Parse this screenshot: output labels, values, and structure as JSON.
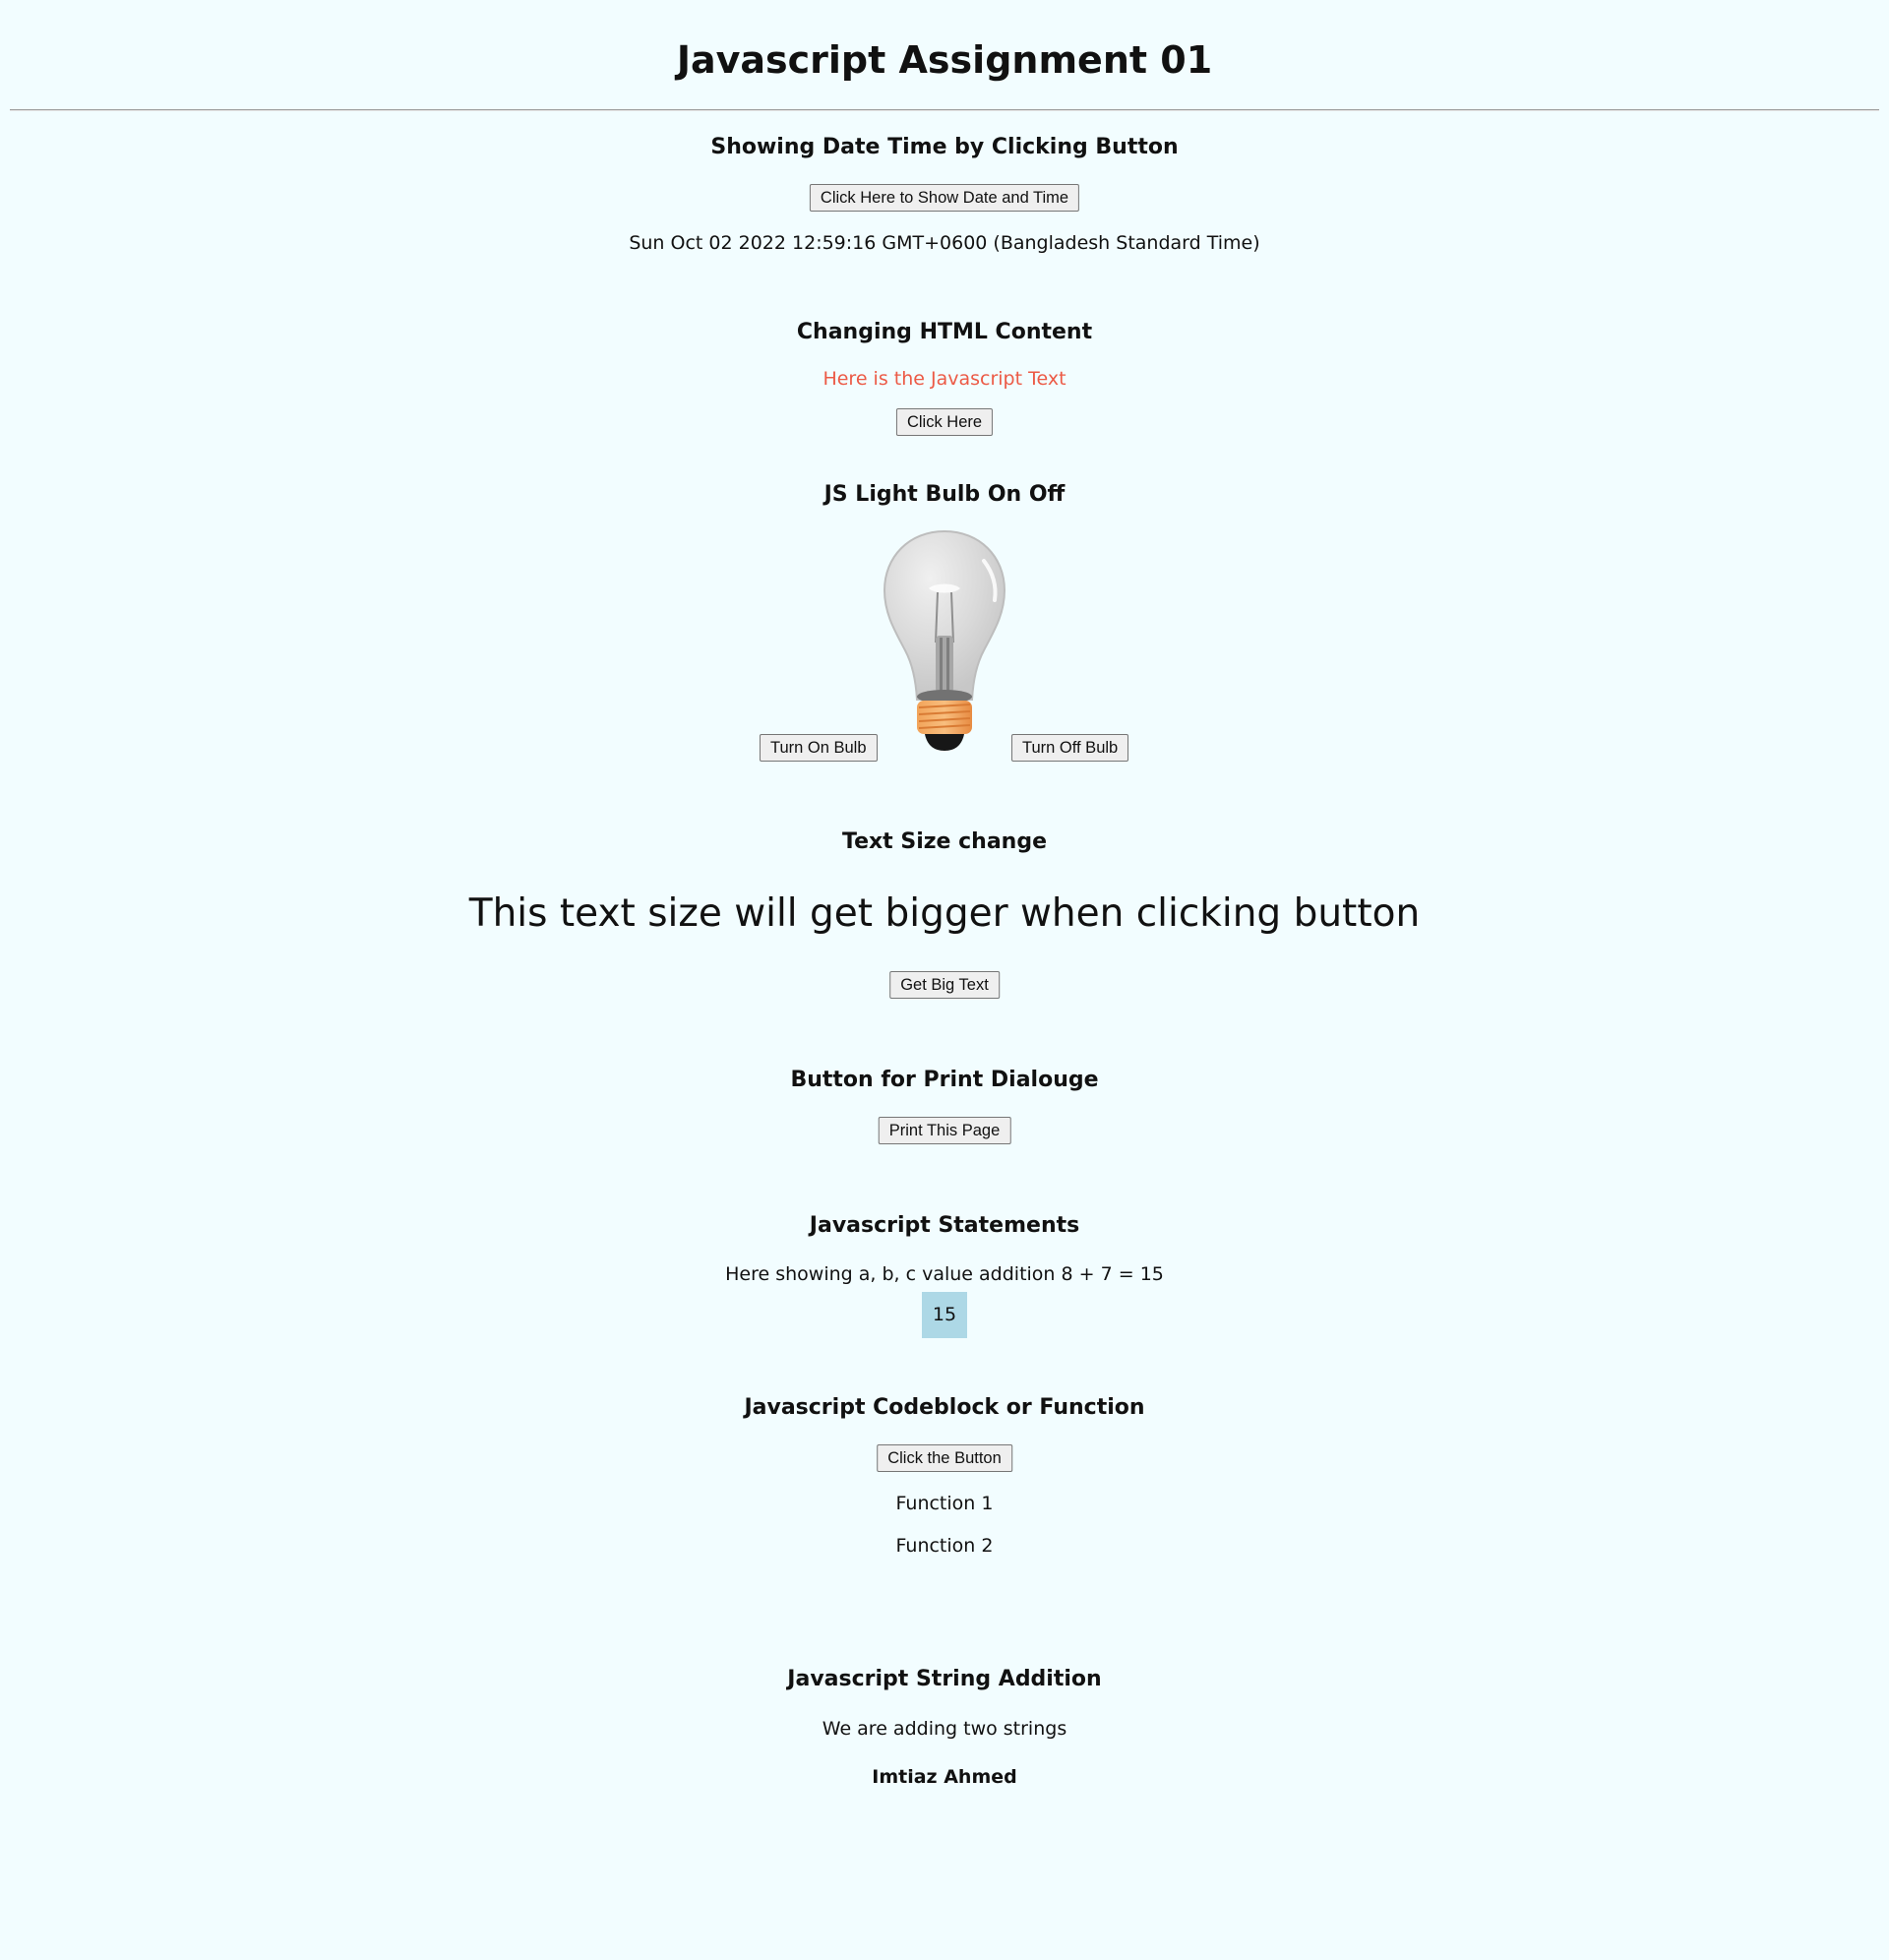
{
  "page": {
    "title": "Javascript Assignment 01"
  },
  "datetime_section": {
    "heading": "Showing Date Time by Clicking Button",
    "button_label": "Click Here to Show Date and Time",
    "output": "Sun Oct 02 2022 12:59:16 GMT+0600 (Bangladesh Standard Time)"
  },
  "html_content_section": {
    "heading": "Changing HTML Content",
    "text": "Here is the Javascript Text",
    "text_color": "#ec5a46",
    "button_label": "Click Here"
  },
  "bulb_section": {
    "heading": "JS Light Bulb On Off",
    "bulb_icon": "light-bulb-off",
    "on_button_label": "Turn On Bulb",
    "off_button_label": "Turn Off Bulb"
  },
  "text_size_section": {
    "heading": "Text Size change",
    "text": "This text size will get bigger when clicking button",
    "button_label": "Get Big Text"
  },
  "print_section": {
    "heading": "Button for Print Dialouge",
    "button_label": "Print This Page"
  },
  "statements_section": {
    "heading": "Javascript Statements",
    "text": "Here showing a, b, c value addition 8 + 7 = 15",
    "result": "15",
    "result_background": "#add8e6"
  },
  "function_section": {
    "heading": "Javascript Codeblock or Function",
    "button_label": "Click the Button",
    "outputs": [
      "Function 1",
      "Function 2"
    ]
  },
  "string_section": {
    "heading": "Javascript String Addition",
    "text": "We are adding two strings",
    "result": "Imtiaz Ahmed"
  }
}
